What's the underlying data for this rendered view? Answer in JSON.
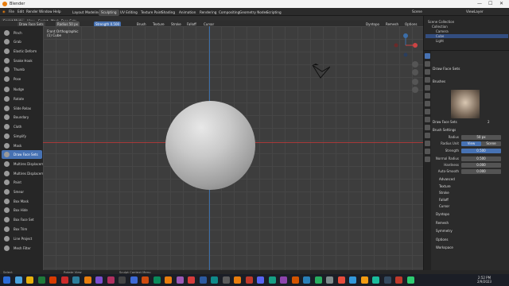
{
  "window": {
    "title": "Blender"
  },
  "menubar": {
    "mode": "Sculpt Mode",
    "items": [
      "View",
      "Sculpt",
      "Mask",
      "Face Sets"
    ],
    "tabs": [
      "Layout",
      "Modeling",
      "Sculpting",
      "UV Editing",
      "Texture Paint",
      "Shading",
      "Animation",
      "Rendering",
      "Compositing",
      "Geometry Nodes",
      "Scripting"
    ],
    "active_tab": "Sculpting",
    "scene": "Scene",
    "view_layer": "ViewLayer"
  },
  "header": {
    "brush": "Draw Face Sets",
    "radius_label": "Radius",
    "radius_value": "50 px",
    "strength_label": "Strength",
    "strength_value": "0.500",
    "menus": [
      "Brush",
      "Texture",
      "Stroke",
      "Falloff",
      "Cursor"
    ],
    "dyntopo": "Dyntopo",
    "remesh": "Remesh",
    "options": "Options"
  },
  "toolbar": {
    "tools": [
      "Draw",
      "Draw Sharp",
      "Clay",
      "Clay Strips",
      "Clay Thumb",
      "Layer",
      "Inflate",
      "Blob",
      "Crease",
      "Smooth",
      "Flatten",
      "Fill",
      "Scrape",
      "Multi-plane Scrape",
      "Pinch",
      "Grab",
      "Elastic Deform",
      "Snake Hook",
      "Thumb",
      "Pose",
      "Nudge",
      "Rotate",
      "Slide Relax",
      "Boundary",
      "Cloth",
      "Simplify",
      "Mask",
      "Draw Face Sets",
      "Multires Displacement Eraser",
      "Multires Displacement Smear",
      "Paint",
      "Smear",
      "Box Mask",
      "Box Hide",
      "Box Face Set",
      "Box Trim",
      "Line Project",
      "Mesh Filter"
    ],
    "active": "Draw Face Sets"
  },
  "viewport": {
    "view": "Front Orthographic",
    "object": "(1) Cube"
  },
  "outliner": {
    "items": [
      {
        "label": "Scene Collection",
        "indent": 0,
        "selected": false
      },
      {
        "label": "Collection",
        "indent": 1,
        "selected": false
      },
      {
        "label": "Camera",
        "indent": 2,
        "selected": false
      },
      {
        "label": "Cube",
        "indent": 2,
        "selected": true
      },
      {
        "label": "Light",
        "indent": 2,
        "selected": false
      }
    ]
  },
  "properties": {
    "tool_name": "Draw Face Sets",
    "brushes_label": "Brushes",
    "brush_name": "Draw Face Sets",
    "brush_users": "2",
    "brush_settings_label": "Brush Settings",
    "radius_label": "Radius",
    "radius_value": "50 px",
    "radius_unit_label": "Radius Unit",
    "radius_unit_options": [
      "View",
      "Scene"
    ],
    "strength_label": "Strength",
    "strength_value": "0.500",
    "normal_radius_label": "Normal Radius",
    "normal_radius_value": "0.500",
    "hardness_label": "Hardness",
    "hardness_value": "0.000",
    "autosmooth_label": "Auto-Smooth",
    "autosmooth_value": "0.000",
    "sections": [
      "Advanced",
      "Texture",
      "Stroke",
      "Falloff",
      "Cursor"
    ],
    "panels": [
      "Dyntopo",
      "Remesh",
      "Symmetry",
      "Options",
      "Workspace"
    ]
  },
  "statusbar": {
    "select": "Select",
    "rotate": "Rotate View",
    "context": "Sculpt Context Menu"
  },
  "taskbar": {
    "time": "2:52 PM",
    "date": "2/9/2023"
  },
  "colors": {
    "accent": "#4772b3",
    "viewport_bg": "#3d3d3d"
  }
}
